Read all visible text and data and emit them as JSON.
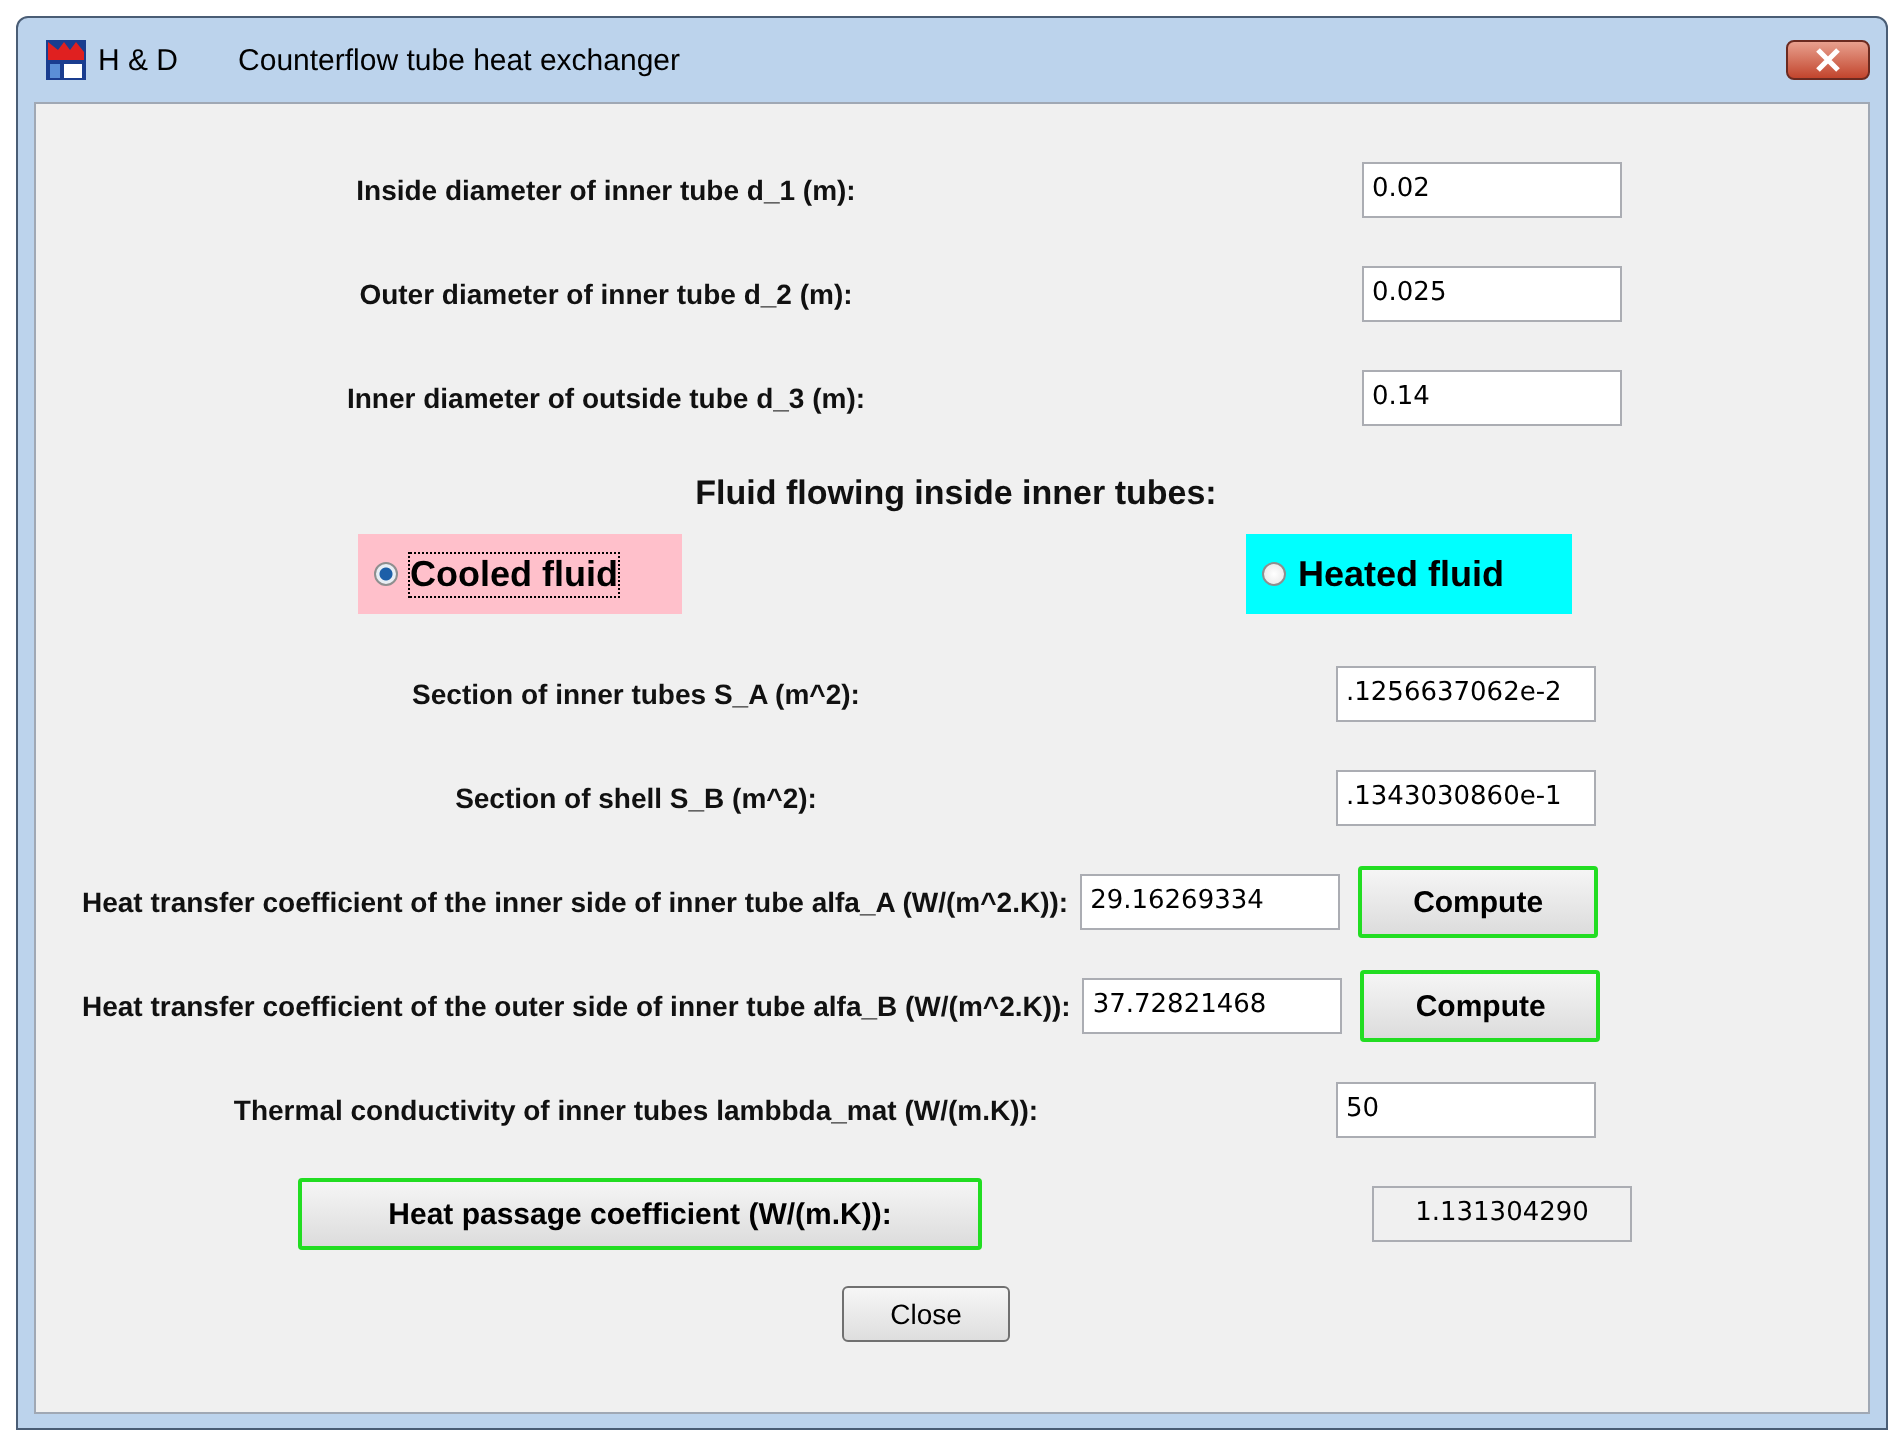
{
  "window": {
    "app": "H & D",
    "title": "Counterflow tube heat exchanger"
  },
  "rows_top": [
    {
      "label": "Inside diameter of inner tube d_1 (m):",
      "value": "0.02",
      "editable": true
    },
    {
      "label": "Outer diameter of inner tube d_2 (m):",
      "value": "0.025",
      "editable": true
    },
    {
      "label": "Inner diameter of outside tube d_3 (m):",
      "value": "0.14",
      "editable": true
    }
  ],
  "fluid_heading": "Fluid flowing inside inner tubes:",
  "radios": [
    {
      "label": "Cooled fluid",
      "selected": true,
      "color": "#ffc0cb"
    },
    {
      "label": "Heated fluid",
      "selected": false,
      "color": "#00ffff"
    }
  ],
  "rows": [
    {
      "kind": "field",
      "label": "Section of inner tubes S_A (m^2):",
      "value": ".1256637062e-2",
      "editable": true
    },
    {
      "kind": "field",
      "label": "Section of shell S_B (m^2):",
      "value": ".1343030860e-1",
      "editable": true
    },
    {
      "kind": "compute",
      "label": "Heat transfer coefficient of the inner side of inner tube alfa_A  (W/(m^2.K)):",
      "value": "29.16269334",
      "editable": true,
      "button": "Compute"
    },
    {
      "kind": "compute",
      "label": "Heat transfer coefficient of the outer side of inner tube alfa_B (W/(m^2.K)):",
      "value": "37.72821468",
      "editable": true,
      "button": "Compute"
    },
    {
      "kind": "field",
      "label": "Thermal conductivity of inner tubes lambbda_mat (W/(m.K)):",
      "value": "50",
      "editable": true
    },
    {
      "kind": "button",
      "label": "Heat passage coefficient (W/(m.K)):",
      "value": "1.131304290",
      "editable": false
    }
  ],
  "close_button": "Close"
}
